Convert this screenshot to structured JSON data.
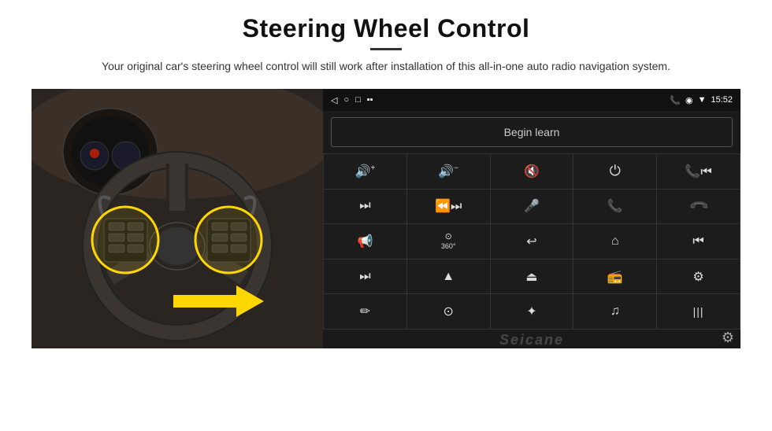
{
  "header": {
    "title": "Steering Wheel Control",
    "divider": true,
    "subtitle": "Your original car's steering wheel control will still work after installation of this all-in-one auto radio navigation system."
  },
  "statusBar": {
    "back": "◁",
    "circle": "○",
    "square": "□",
    "battery": "▪▪",
    "phone": "📞",
    "location": "◉",
    "wifi": "▼",
    "time": "15:52"
  },
  "beginLearn": {
    "label": "Begin learn"
  },
  "controls": {
    "rows": [
      [
        "vol+",
        "vol-",
        "mute",
        "power",
        "prev-track"
      ],
      [
        "next",
        "ff-back",
        "mic",
        "phone",
        "hang-up"
      ],
      [
        "speaker",
        "360",
        "back",
        "home",
        "skip-back"
      ],
      [
        "skip-fwd",
        "nav",
        "eject",
        "radio",
        "equalizer"
      ],
      [
        "pen",
        "settings-ring",
        "bluetooth",
        "music",
        "bars"
      ]
    ],
    "icons": {
      "vol+": "🔊+",
      "vol-": "🔊-",
      "mute": "🔇",
      "power": "⏻",
      "prev-track": "⏮",
      "next": "⏭",
      "ff-back": "⏪",
      "mic": "🎤",
      "phone": "📞",
      "hang-up": "📵",
      "speaker": "📢",
      "360": "360",
      "back": "↩",
      "home": "⌂",
      "skip-back": "⏮",
      "skip-fwd": "⏭",
      "nav": "▲",
      "eject": "⏏",
      "radio": "📻",
      "equalizer": "⚙",
      "pen": "✏",
      "settings-ring": "⊙",
      "bluetooth": "✦",
      "music": "♫",
      "bars": "▐▐▐"
    }
  },
  "watermark": {
    "text": "Seicane"
  },
  "colors": {
    "background": "#ffffff",
    "androidBg": "#1a1a1a",
    "statusBar": "#111111",
    "buttonBg": "#1c1c1c",
    "buttonBorder": "#333333",
    "textLight": "#cccccc",
    "highlight": "#FFD700"
  }
}
